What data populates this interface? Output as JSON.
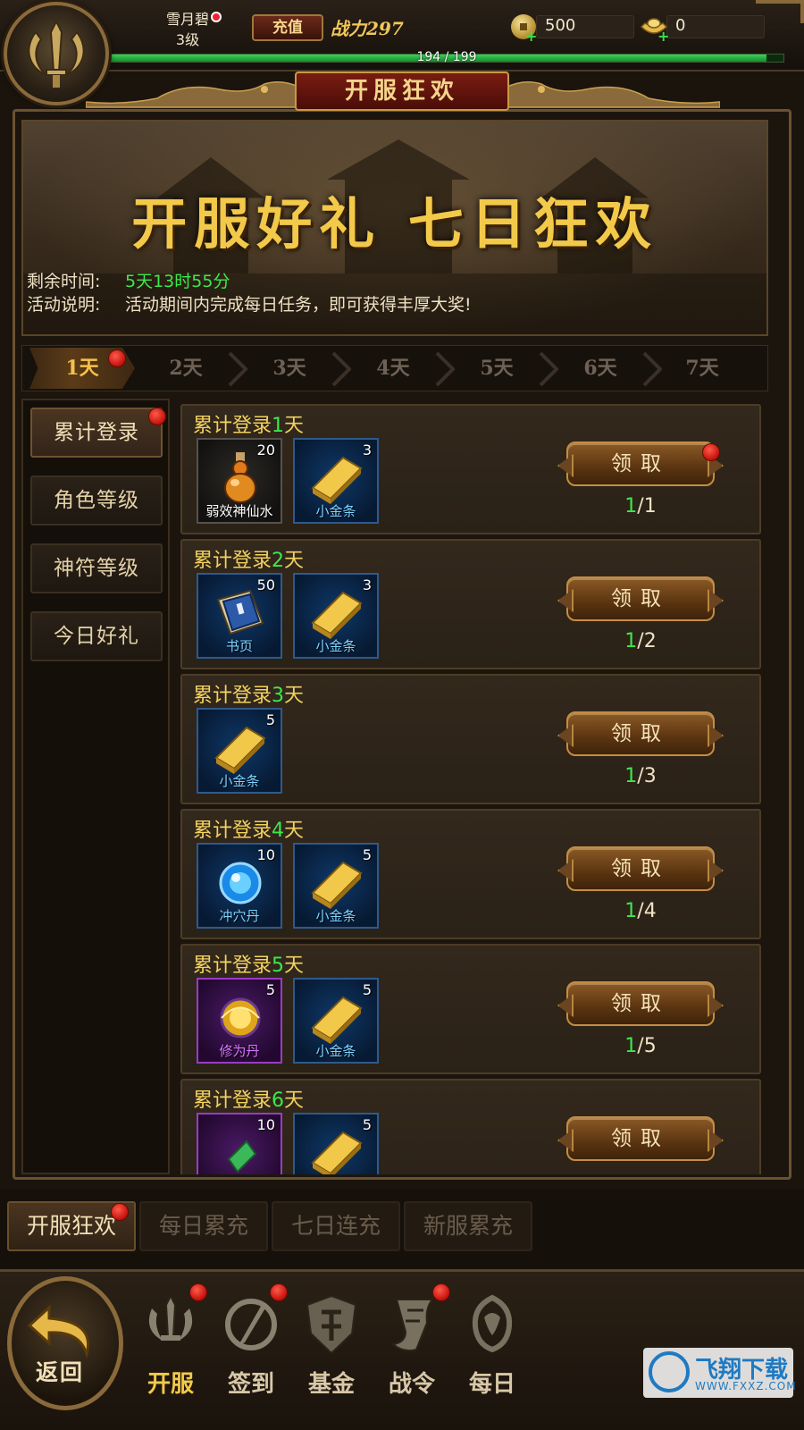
{
  "header": {
    "player_name": "雪月碧",
    "player_level": "3级",
    "recharge_label": "充值",
    "power_text": "战力297",
    "coins": "500",
    "ingots": "0",
    "exp_text": "194 / 199",
    "exp_fraction": 0.975
  },
  "title": "开服狂欢",
  "banner": {
    "slogan": "开服好礼 七日狂欢",
    "remain_label": "剩余时间:",
    "remain_value": "5天13时55分",
    "desc_label": "活动说明:",
    "desc_value": "活动期间内完成每日任务，即可获得丰厚大奖!"
  },
  "day_tabs": [
    "1天",
    "2天",
    "3天",
    "4天",
    "5天",
    "6天",
    "7天"
  ],
  "categories": [
    "累计登录",
    "角色等级",
    "神符等级",
    "今日好礼"
  ],
  "tasks": [
    {
      "title_prefix": "累计登录",
      "title_num": "1",
      "title_suffix": "天",
      "items": [
        {
          "name": "弱效神仙水",
          "count": "20",
          "icon": "potion-icon",
          "frame": "dark"
        },
        {
          "name": "小金条",
          "count": "3",
          "icon": "gold-bar-icon",
          "frame": "blue"
        }
      ],
      "claim_label": "领取",
      "progress_done": "1",
      "progress_total": "/1"
    },
    {
      "title_prefix": "累计登录",
      "title_num": "2",
      "title_suffix": "天",
      "items": [
        {
          "name": "书页",
          "count": "50",
          "icon": "book-page-icon",
          "frame": "blue"
        },
        {
          "name": "小金条",
          "count": "3",
          "icon": "gold-bar-icon",
          "frame": "blue"
        }
      ],
      "claim_label": "领取",
      "progress_done": "1",
      "progress_total": "/2"
    },
    {
      "title_prefix": "累计登录",
      "title_num": "3",
      "title_suffix": "天",
      "items": [
        {
          "name": "小金条",
          "count": "5",
          "icon": "gold-bar-icon",
          "frame": "blue"
        }
      ],
      "claim_label": "领取",
      "progress_done": "1",
      "progress_total": "/3"
    },
    {
      "title_prefix": "累计登录",
      "title_num": "4",
      "title_suffix": "天",
      "items": [
        {
          "name": "冲穴丹",
          "count": "10",
          "icon": "blue-orb-icon",
          "frame": "blue"
        },
        {
          "name": "小金条",
          "count": "5",
          "icon": "gold-bar-icon",
          "frame": "blue"
        }
      ],
      "claim_label": "领取",
      "progress_done": "1",
      "progress_total": "/4"
    },
    {
      "title_prefix": "累计登录",
      "title_num": "5",
      "title_suffix": "天",
      "items": [
        {
          "name": "修为丹",
          "count": "5",
          "icon": "gold-orb-icon",
          "frame": "purple"
        },
        {
          "name": "小金条",
          "count": "5",
          "icon": "gold-bar-icon",
          "frame": "blue"
        }
      ],
      "claim_label": "领取",
      "progress_done": "1",
      "progress_total": "/5"
    },
    {
      "title_prefix": "累计登录",
      "title_num": "6",
      "title_suffix": "天",
      "items": [
        {
          "name": "",
          "count": "10",
          "icon": "green-gem-icon",
          "frame": "purple"
        },
        {
          "name": "",
          "count": "5",
          "icon": "gold-bar-icon",
          "frame": "blue"
        }
      ],
      "claim_label": "领取",
      "progress_done": "",
      "progress_total": ""
    }
  ],
  "activity_tabs": [
    "开服狂欢",
    "每日累充",
    "七日连充",
    "新服累充"
  ],
  "nav": {
    "back_label": "返回",
    "items": [
      "开服",
      "签到",
      "基金",
      "战令",
      "每日"
    ]
  },
  "watermark": {
    "name": "飞翔下载",
    "url": "WWW.FXXZ.COM"
  }
}
